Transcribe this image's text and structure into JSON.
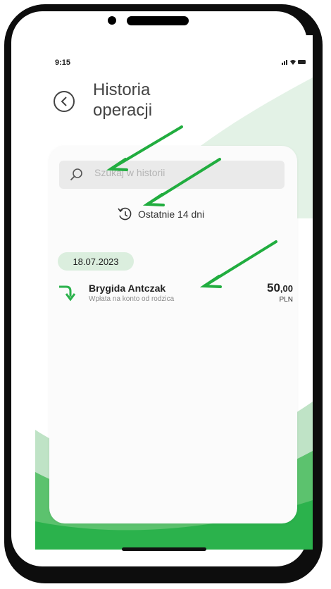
{
  "status_bar": {
    "time": "9:15",
    "icons": "signal wifi battery"
  },
  "header": {
    "back_icon": "back-chevron-icon",
    "title": "Historia\noperacji"
  },
  "search": {
    "placeholder": "Szukaj w historii"
  },
  "filter": {
    "icon": "history-icon",
    "label": "Ostatnie 14 dni"
  },
  "transactions": [
    {
      "date": "18.07.2023",
      "name": "Brygida Antczak",
      "description": "Wpłata na konto od rodzica",
      "amount_int": "50",
      "amount_dec": ",00",
      "currency": "PLN",
      "icon": "incoming-transfer-icon"
    }
  ],
  "colors": {
    "accent": "#2bb24c",
    "annotation_arrow": "#21ad3f",
    "frame": "#0d0d0d"
  }
}
